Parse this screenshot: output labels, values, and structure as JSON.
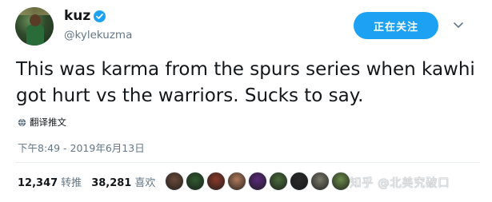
{
  "user": {
    "display_name": "kuz",
    "handle": "@kylekuzma",
    "verified": true
  },
  "follow_button": {
    "label": "正在关注",
    "color": "#1da1f2"
  },
  "tweet": {
    "text": "This was karma from the spurs series when kawhi got hurt vs the warriors. Sucks to say.",
    "translate_label": "翻译推文",
    "timestamp": "下午8:49 - 2019年6月13日"
  },
  "stats": {
    "retweets_count": "12,347",
    "retweets_label": "转推",
    "likes_count": "38,281",
    "likes_label": "喜欢"
  },
  "liker_avatar_colors": [
    "#6b4a3a",
    "#2f5a2f",
    "#8a3a2a",
    "#b07a5a",
    "#5a2a7a",
    "#4a6a3a",
    "#2a2a2a",
    "#7a7a6a",
    "#6a8a4a"
  ],
  "watermark": "知乎 @北美究破口",
  "icons": [
    "verified-icon",
    "chevron-down-icon",
    "globe-icon"
  ],
  "accent_color": "#1da1f2"
}
